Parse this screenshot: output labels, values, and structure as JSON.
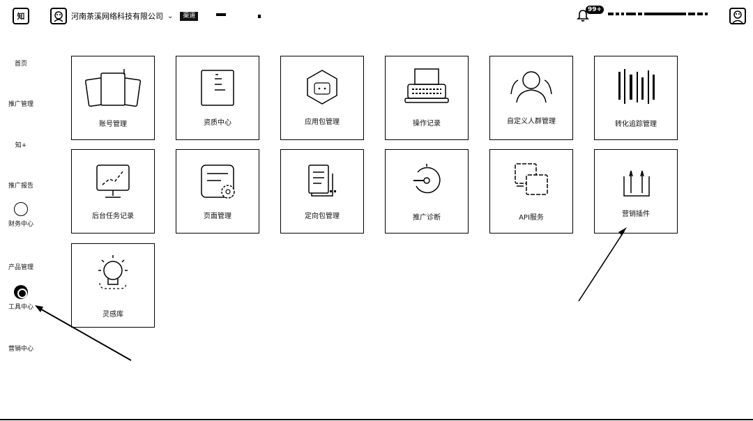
{
  "topbar": {
    "logo_text": "知",
    "account_name": "河南茶溪网络科技有限公司",
    "account_chevron": "⌄",
    "tag": "渠道",
    "notification_badge": "99+"
  },
  "sidebar": {
    "items": [
      {
        "label": "首页",
        "icon": "none"
      },
      {
        "label": "推广管理",
        "icon": "none"
      },
      {
        "label": "知+",
        "icon": "none"
      },
      {
        "label": "推广报告",
        "icon": "none"
      },
      {
        "label": "财务中心",
        "icon": "circle-icon"
      },
      {
        "label": "产品管理",
        "icon": "none"
      },
      {
        "label": "工具中心",
        "icon": "tool-icon"
      },
      {
        "label": "营销中心",
        "icon": "none"
      }
    ]
  },
  "tools": [
    {
      "label": "账号管理",
      "icon": "cards-icon"
    },
    {
      "label": "资质中心",
      "icon": "document-icon"
    },
    {
      "label": "应用包管理",
      "icon": "hexagon-icon"
    },
    {
      "label": "操作记录",
      "icon": "typewriter-icon"
    },
    {
      "label": "自定义人群管理",
      "icon": "people-icon"
    },
    {
      "label": "转化追踪管理",
      "icon": "barcode-icon"
    },
    {
      "label": "后台任务记录",
      "icon": "monitor-chart-icon"
    },
    {
      "label": "页面管理",
      "icon": "page-gear-icon"
    },
    {
      "label": "定向包管理",
      "icon": "document-list-icon"
    },
    {
      "label": "推广诊断",
      "icon": "diagnosis-icon"
    },
    {
      "label": "API服务",
      "icon": "api-blocks-icon"
    },
    {
      "label": "营销插件",
      "icon": "plugin-icon"
    },
    {
      "label": "灵感库",
      "icon": "lightbulb-icon"
    }
  ],
  "colors": {
    "ink": "#000000",
    "background": "#ffffff"
  }
}
